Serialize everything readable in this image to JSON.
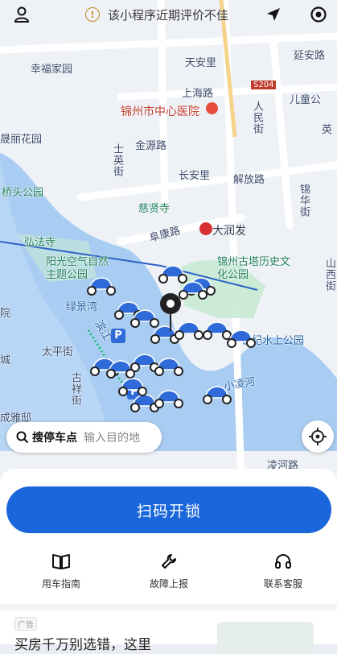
{
  "notice": {
    "text": "该小程序近期评价不佳"
  },
  "map_labels": {
    "xinfu": "幸福家园",
    "tiananli": "天安里",
    "yanansi": "延安路",
    "shanghai": "上海路",
    "s204": "S204",
    "hospital": "锦州市中心医院",
    "ertong": "儿童公",
    "renmin": "人民街",
    "yinghua": "英",
    "shengli": "晟丽花园",
    "jinyuan": "金源路",
    "shiying": "士英街",
    "changan": "长安里",
    "jiefang": "解放路",
    "jinhua": "锦华街",
    "qiaotou": "桥头公园",
    "ciaisi": "慈贤寺",
    "fukang": "阜康路",
    "darunfa": "大润发",
    "hongfa": "弘法寺",
    "yangguang": "阳光空气自然主题公园",
    "gutai": "锦州古塔历史文化公园",
    "shanxi": "山西街",
    "lvjing": "绿景湾",
    "binjiang": "滨江",
    "shiji": "世纪水上公园",
    "taiping": "太平街",
    "cheng": "城",
    "guxiang": "古祥街",
    "xiaolinghe": "小凌河",
    "chengyadi": "成雅邸",
    "yuan": "院",
    "linghe": "凌河路"
  },
  "search": {
    "label": "搜停车点",
    "placeholder": "输入目的地"
  },
  "sheet": {
    "scan_label": "扫码开锁",
    "actions": [
      {
        "label": "用车指南",
        "icon": "book-icon"
      },
      {
        "label": "故障上报",
        "icon": "wrench-icon"
      },
      {
        "label": "联系客服",
        "icon": "headset-icon"
      }
    ]
  },
  "ad": {
    "tag": "广告",
    "title": "买房千万别选错，这里"
  },
  "colors": {
    "accent": "#1a66db",
    "water": "#a9cdf2",
    "bike": "#2f6bd8"
  }
}
